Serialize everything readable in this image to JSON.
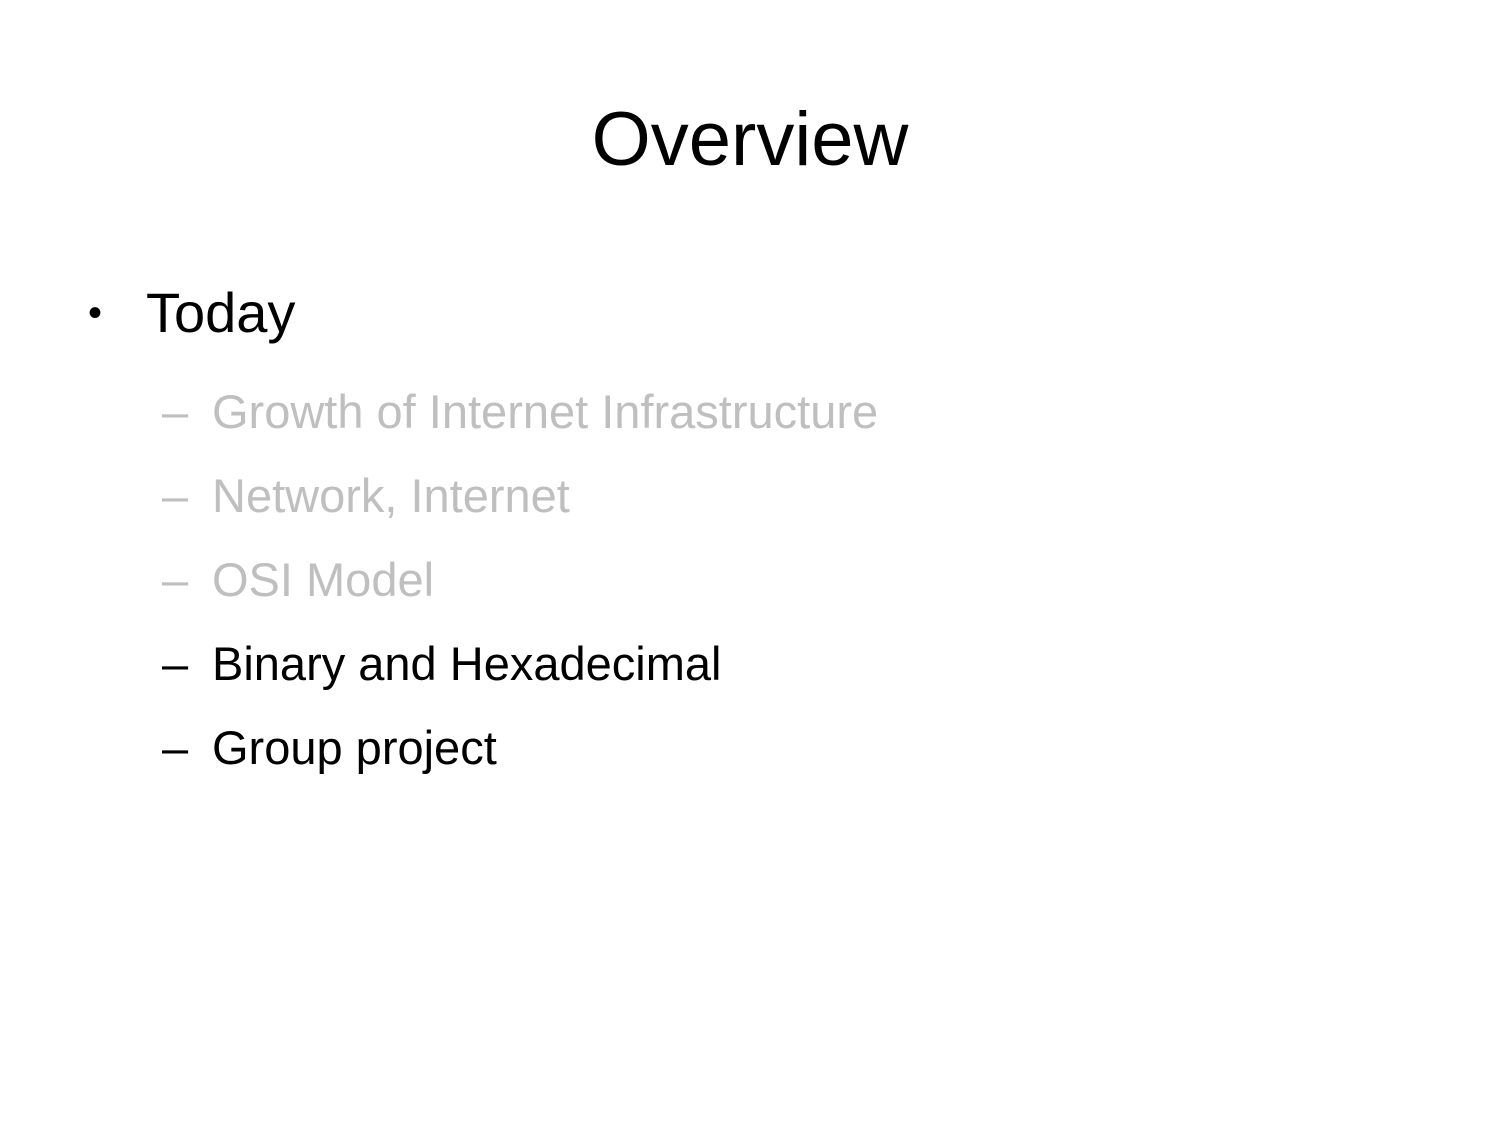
{
  "slide": {
    "title": "Overview",
    "main_bullet": {
      "marker": "•",
      "label": "Today"
    },
    "sub_items": [
      {
        "marker": "–",
        "label": "Growth of Internet Infrastructure",
        "state": "dimmed"
      },
      {
        "marker": "–",
        "label": "Network, Internet",
        "state": "dimmed"
      },
      {
        "marker": "–",
        "label": "OSI Model",
        "state": "dimmed"
      },
      {
        "marker": "–",
        "label": "Binary and Hexadecimal",
        "state": "active"
      },
      {
        "marker": "–",
        "label": "Group project",
        "state": "active"
      }
    ]
  },
  "colors": {
    "background": "#ffffff",
    "text_active": "#000000",
    "text_dimmed": "#bfbfbf"
  }
}
